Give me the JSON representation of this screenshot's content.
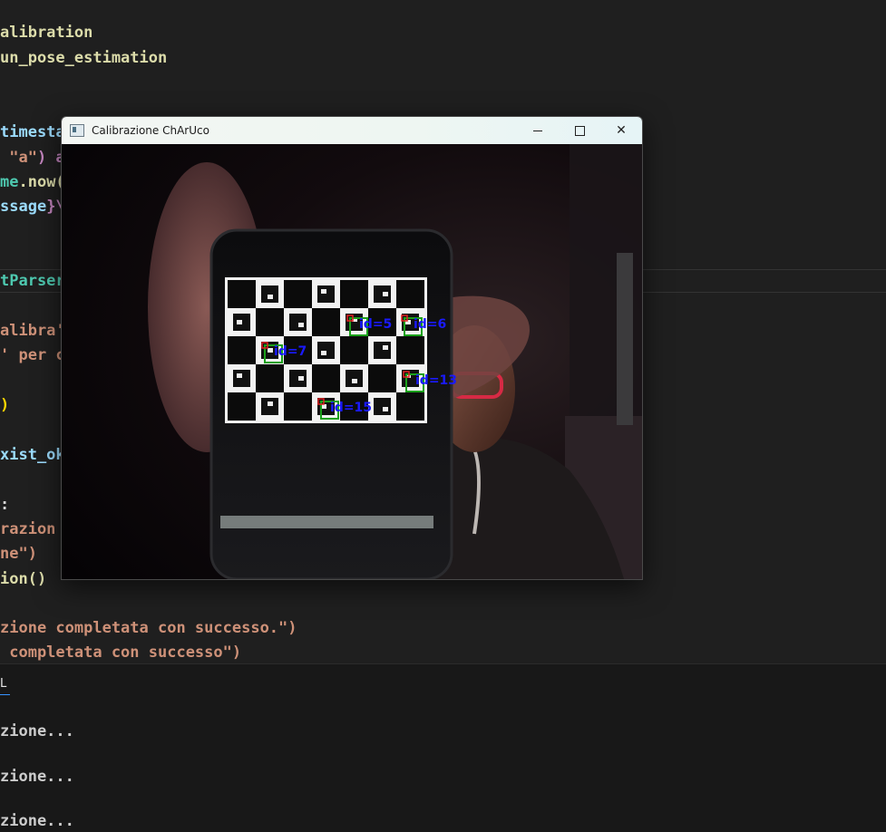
{
  "editor": {
    "lines": [
      [
        {
          "t": "alibration",
          "c": "ident"
        }
      ],
      [
        {
          "t": "un_pose_estimation",
          "c": "ident"
        }
      ],
      [
        {
          "t": "timesta",
          "c": "var"
        }
      ],
      [
        {
          "t": " \"a\"",
          "c": "str"
        },
        {
          "t": ") a",
          "c": "kw"
        }
      ],
      [
        {
          "t": "me",
          "c": "class"
        },
        {
          "t": ".now(",
          "c": "ident"
        }
      ],
      [
        {
          "t": "ssage",
          "c": "var"
        },
        {
          "t": "}\\",
          "c": "kw"
        }
      ],
      [
        {
          "t": "tParser",
          "c": "class"
        }
      ],
      [
        {
          "t": "alibra'",
          "c": "str"
        }
      ],
      [
        {
          "t": "' per c",
          "c": "str"
        }
      ],
      [
        {
          "t": ")",
          "c": "paren"
        }
      ],
      [
        {
          "t": "xist_ok",
          "c": "var"
        }
      ],
      [
        {
          "t": ":",
          "c": "plain"
        }
      ],
      [
        {
          "t": "razion",
          "c": "str"
        }
      ],
      [
        {
          "t": "ne\")",
          "c": "str"
        }
      ],
      [
        {
          "t": "ion()",
          "c": "ident"
        }
      ],
      [
        {
          "t": "zione completata con successo.\")",
          "c": "str"
        }
      ],
      [
        {
          "t": " completata con successo\")",
          "c": "str"
        }
      ]
    ]
  },
  "panel": {
    "tab_label": "L",
    "lines": [
      "zione...",
      "zione...",
      "zione..."
    ]
  },
  "window": {
    "title": "Calibrazione ChArUco",
    "markers": [
      {
        "label": "id=5"
      },
      {
        "label": "id=6"
      },
      {
        "label": "id=7"
      },
      {
        "label": "id=13"
      },
      {
        "label": "id=15"
      }
    ]
  },
  "colors": {
    "marker_label": "#1a1aff",
    "marker_box": "#1aa01a",
    "marker_corner": "#e02020"
  }
}
